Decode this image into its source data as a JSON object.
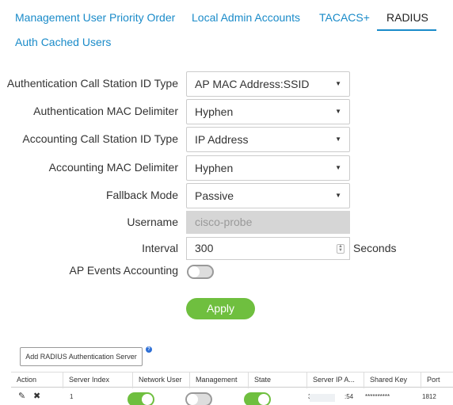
{
  "tabs": [
    {
      "label": "Management User Priority Order",
      "active": false
    },
    {
      "label": "Local Admin Accounts",
      "active": false
    },
    {
      "label": "TACACS+",
      "active": false
    },
    {
      "label": "RADIUS",
      "active": true
    },
    {
      "label": "Auth Cached Users",
      "active": false
    }
  ],
  "form": {
    "auth_call_station_id_type": {
      "label": "Authentication Call Station ID Type",
      "value": "AP MAC Address:SSID"
    },
    "auth_mac_delimiter": {
      "label": "Authentication MAC Delimiter",
      "value": "Hyphen"
    },
    "acct_call_station_id_type": {
      "label": "Accounting Call Station ID Type",
      "value": "IP Address"
    },
    "acct_mac_delimiter": {
      "label": "Accounting MAC Delimiter",
      "value": "Hyphen"
    },
    "fallback_mode": {
      "label": "Fallback Mode",
      "value": "Passive"
    },
    "username": {
      "label": "Username",
      "value": "cisco-probe"
    },
    "interval": {
      "label": "Interval",
      "value": "300",
      "unit": "Seconds"
    },
    "ap_events_accounting": {
      "label": "AP Events Accounting",
      "enabled": false
    },
    "apply_label": "Apply"
  },
  "servers": {
    "add_button_label": "Add RADIUS Authentication Server",
    "help_glyph": "?",
    "columns": [
      "Action",
      "Server Index",
      "Network User",
      "Management",
      "State",
      "Server IP A...",
      "Shared Key",
      "Port"
    ],
    "rows": [
      {
        "index": "1",
        "network_user": true,
        "management": false,
        "state": true,
        "server_ip_prefix": "3.",
        "server_ip_suffix": ":54",
        "shared_key": "**********",
        "port": "1812"
      }
    ]
  },
  "icons": {
    "edit": "edit-icon",
    "delete": "delete-icon",
    "caret": "chevron-down-icon",
    "spinner": "spinner-icon"
  },
  "colors": {
    "accent": "#1a8bc9",
    "toggle_on": "#6fbf3f",
    "apply": "#6fbf3f",
    "disabled_input": "#d6d6d6"
  }
}
